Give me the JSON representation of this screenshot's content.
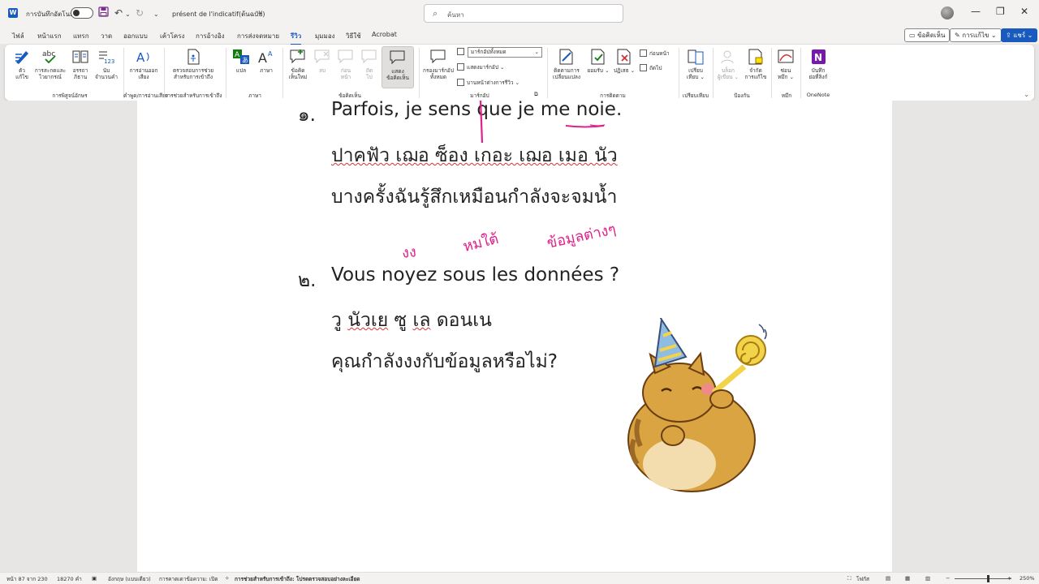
{
  "titlebar": {
    "app_icon": "W",
    "autosave_label": "การบันทึกอัตโนมัติ",
    "document_title": "présent de l'indicatif(ต้นฉบับ)",
    "title_dropdown": "∨",
    "search_placeholder": "ค้นหา",
    "icons": [
      "save-icon",
      "undo-icon",
      "redo-icon",
      "customize-toolbar-icon",
      "search-icon"
    ]
  },
  "menu": {
    "tabs": [
      "ไฟล์",
      "หน้าแรก",
      "แทรก",
      "วาด",
      "ออกแบบ",
      "เค้าโครง",
      "การอ้างอิง",
      "การส่งจดหมาย",
      "รีวิว",
      "มุมมอง",
      "วิธีใช้",
      "Acrobat"
    ],
    "active_tab": "รีวิว",
    "comments_button": "ข้อคิดเห็น",
    "editing_button": "การแก้ไข",
    "share_button": "แชร์"
  },
  "ribbon": {
    "proofing": {
      "spell": "ตัว\nแก้ไข",
      "grammar": "การสะกดและ\nไวยากรณ์",
      "thesaurus": "อรรถา\nภิธาน",
      "wordcount": "นับ\nจำนวนคำ",
      "group": "การพิสูจน์อักษร"
    },
    "speech": {
      "read_aloud": "การอ่านออก\nเสียง",
      "group": "คำพูด/การอ่านเสียง"
    },
    "accessibility": {
      "check": "ตรวจสอบการช่วย\nสำหรับการเข้าถึง",
      "group": "การช่วยสำหรับการเข้าถึง"
    },
    "language": {
      "translate": "แปล",
      "language": "ภาษา",
      "group": "ภาษา"
    },
    "comments": {
      "new": "ข้อคิด\nเห็นใหม่",
      "delete": "ลบ",
      "previous": "ก่อน\nหน้า",
      "next": "ถัด\nไป",
      "show": "แสดง\nข้อคิดเห็น",
      "group": "ข้อคิดเห็น"
    },
    "tracking": {
      "markup_area": "กรองมาร์กอัป\nทั้งหมด",
      "markup_select": "มาร์กอัปทั้งหมด",
      "show_markup": "แสดงมาร์กอัป",
      "reviewing_pane": "บานหน้าต่างการรีวิว",
      "group": "มาร์กอัป"
    },
    "changes": {
      "track": "ติดตามการ\nเปลี่ยนแปลง",
      "accept": "ยอมรับ",
      "reject": "ปฏิเสธ",
      "previous": "ก่อนหน้า",
      "next": "ถัดไป",
      "group": "การติดตาม"
    },
    "compare": {
      "compare": "เปรียบ\nเทียบ",
      "group": "เปรียบเทียบ"
    },
    "protect": {
      "block": "บล็อก\nผู้เขียน",
      "restrict": "จำกัด\nการแก้ไข",
      "group": "ป้องกัน"
    },
    "ink": {
      "hide": "ซ่อน\nหมึก",
      "group": "หมึก"
    },
    "onenote": {
      "linked": "บันทึก\nย่อที่ลิงก์",
      "group": "OneNote"
    }
  },
  "document": {
    "item1": {
      "number": "๑.",
      "french": "Parfois, je sens que je me noie.",
      "translit": "ปาคฟัว เฌอ ซ็อง เกอะ เฌอ เมอ นัว",
      "thai": "บางครั้งฉันรู้สึกเหมือนกำลังจะจมน้ำ"
    },
    "handnotes": {
      "note1": "งง",
      "note2": "หมใต้",
      "note3": "ข้อมูลต่างๆ"
    },
    "item2": {
      "number": "๒.",
      "french": "Vous noyez sous les données ?",
      "translit_a": "วู ",
      "translit_b": "นัวเย",
      "translit_c": " ซู ",
      "translit_d": "เล",
      "translit_e": " ดอนเน",
      "thai": "คุณกำลังงงกับข้อมูลหรือไม่?"
    },
    "sticker": "party-cat-sticker"
  },
  "status": {
    "page": "หน้า 87 จาก 230",
    "words": "18270 คำ",
    "language": "อังกฤษ (แบบเดียว)",
    "text_predictions": "การคาดเดาข้อความ: เปิด",
    "accessibility": "การช่วยสำหรับการเข้าถึง: โปรดตรวจสอบอย่างละเอียด",
    "focus": "โฟกัส",
    "zoom": "250%"
  }
}
